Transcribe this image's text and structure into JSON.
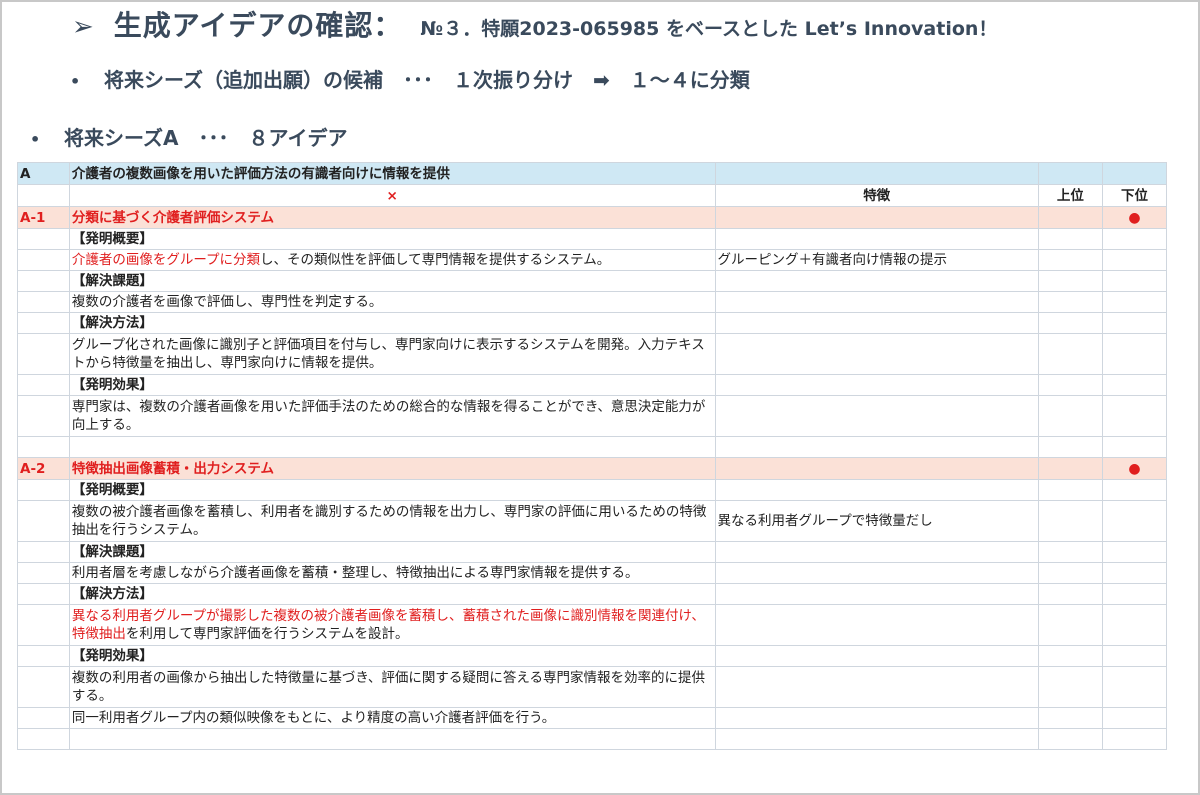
{
  "header": {
    "arrow": "➢",
    "title": "生成アイデアの確認：",
    "subtitle": "№３．特願2023-065985 をベースとした Let’s Innovation！"
  },
  "bullets": {
    "dot": "•",
    "line1": "将来シーズ（追加出願）の候補　･･･　１次振り分け　➡　１～４に分類",
    "line2": "将来シーズA　･･･　８アイデア"
  },
  "table": {
    "header": {
      "code": "A",
      "title": "介護者の複数画像を用いた評価方法の有識者向けに情報を提供"
    },
    "subheader": {
      "cross": "×",
      "feature": "特徴",
      "upper": "上位",
      "lower": "下位"
    },
    "mark": "●",
    "ideas": [
      {
        "code": "A-1",
        "name": "分類に基づく介護者評価システム",
        "overview_label": "【発明概要】",
        "overview_red": "介護者の画像をグループに分類",
        "overview_rest": "し、その類似性を評価して専門情報を提供するシステム。",
        "feature": "グルーピング＋有識者向け情報の提示",
        "problem_label": "【解決課題】",
        "problem": "複数の介護者を画像で評価し、専門性を判定する。",
        "method_label": "【解決方法】",
        "method": "グループ化された画像に識別子と評価項目を付与し、専門家向けに表示するシステムを開発。入力テキストから特徴量を抽出し、専門家向けに情報を提供。",
        "effect_label": "【発明効果】",
        "effect": "専門家は、複数の介護者画像を用いた評価手法のための総合的な情報を得ることができ、意思決定能力が向上する。"
      },
      {
        "code": "A-2",
        "name": "特徴抽出画像蓄積・出力システム",
        "overview_label": "【発明概要】",
        "overview": "複数の被介護者画像を蓄積し、利用者を識別するための情報を出力し、専門家の評価に用いるための特徴抽出を行うシステム。",
        "feature": "異なる利用者グループで特徴量だし",
        "problem_label": "【解決課題】",
        "problem": "利用者層を考慮しながら介護者画像を蓄積・整理し、特徴抽出による専門家情報を提供する。",
        "method_label": "【解決方法】",
        "method_red": "異なる利用者グループが撮影した複数の被介護者画像を蓄積し、蓄積された画像に識別情報を関連付け、特徴抽出",
        "method_rest": "を利用して専門家評価を行うシステムを設計。",
        "effect_label": "【発明効果】",
        "effect": "複数の利用者の画像から抽出した特徴量に基づき、評価に関する疑問に答える専門家情報を効率的に提供する。",
        "effect2": "同一利用者グループ内の類似映像をもとに、より精度の高い介護者評価を行う。"
      }
    ]
  }
}
